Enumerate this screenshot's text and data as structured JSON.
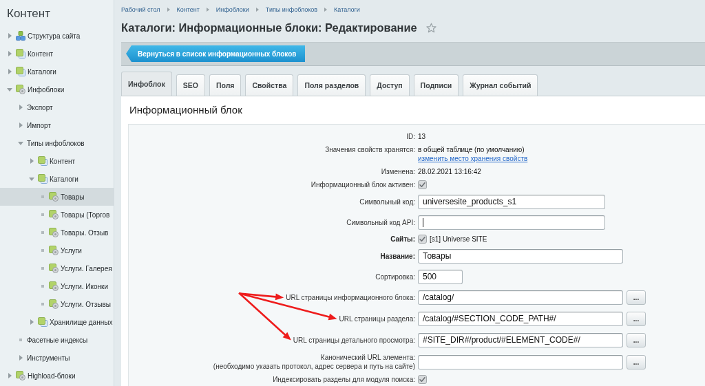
{
  "sidebar": {
    "title": "Контент",
    "items": [
      {
        "label": "Структура сайта",
        "kind": "structure",
        "leaf": false,
        "expanded": false,
        "selected": false
      },
      {
        "label": "Контент",
        "kind": "folder",
        "leaf": false,
        "expanded": false,
        "selected": false
      },
      {
        "label": "Каталоги",
        "kind": "folder",
        "leaf": false,
        "expanded": false,
        "selected": false
      },
      {
        "label": "Инфоблоки",
        "kind": "iblock",
        "leaf": false,
        "expanded": true,
        "selected": false,
        "children": [
          {
            "label": "Экспорт",
            "leaf": false,
            "expanded": false,
            "selected": false
          },
          {
            "label": "Импорт",
            "leaf": false,
            "expanded": false,
            "selected": false
          },
          {
            "label": "Типы инфоблоков",
            "leaf": false,
            "expanded": true,
            "selected": false,
            "children": [
              {
                "label": "Контент",
                "kind": "folder",
                "leaf": false,
                "expanded": false,
                "selected": false
              },
              {
                "label": "Каталоги",
                "kind": "folder",
                "leaf": false,
                "expanded": true,
                "selected": false,
                "children": [
                  {
                    "label": "Товары",
                    "kind": "iblock",
                    "leaf": true,
                    "selected": true
                  },
                  {
                    "label": "Товары (Торгов",
                    "kind": "iblock",
                    "leaf": true,
                    "selected": false
                  },
                  {
                    "label": "Товары. Отзыв",
                    "kind": "iblock",
                    "leaf": true,
                    "selected": false
                  },
                  {
                    "label": "Услуги",
                    "kind": "iblock",
                    "leaf": true,
                    "selected": false
                  },
                  {
                    "label": "Услуги. Галерея",
                    "kind": "iblock",
                    "leaf": true,
                    "selected": false
                  },
                  {
                    "label": "Услуги. Иконки",
                    "kind": "iblock",
                    "leaf": true,
                    "selected": false
                  },
                  {
                    "label": "Услуги. Отзывы",
                    "kind": "iblock",
                    "leaf": true,
                    "selected": false
                  }
                ]
              },
              {
                "label": "Хранилище данных",
                "kind": "folder",
                "leaf": false,
                "expanded": false,
                "selected": false
              }
            ]
          },
          {
            "label": "Фасетные индексы",
            "leaf": true,
            "selected": false
          },
          {
            "label": "Инструменты",
            "leaf": false,
            "expanded": false,
            "selected": false
          }
        ]
      },
      {
        "label": "Highload-блоки",
        "kind": "iblock",
        "leaf": false,
        "expanded": false,
        "selected": false
      }
    ]
  },
  "breadcrumbs": [
    "Рабочий стол",
    "Контент",
    "Инфоблоки",
    "Типы инфоблоков",
    "Каталоги"
  ],
  "page": {
    "title": "Каталоги: Информационные блоки: Редактирование",
    "favorite": false
  },
  "toolbar": {
    "back_button": "Вернуться в список информационных блоков"
  },
  "tabs": [
    {
      "label": "Инфоблок",
      "selected": true
    },
    {
      "label": "SEO",
      "selected": false
    },
    {
      "label": "Поля",
      "selected": false
    },
    {
      "label": "Свойства",
      "selected": false
    },
    {
      "label": "Поля разделов",
      "selected": false
    },
    {
      "label": "Доступ",
      "selected": false
    },
    {
      "label": "Подписи",
      "selected": false
    },
    {
      "label": "Журнал событий",
      "selected": false
    }
  ],
  "panel": {
    "title": "Информационный блок",
    "rows": [
      {
        "kind": "text",
        "label": "ID:",
        "required": false,
        "value": "13"
      },
      {
        "kind": "text",
        "label": "Значения свойств хранятся:",
        "required": false,
        "value": "в общей таблице (по умолчанию)",
        "link": "изменить место хранения свойств"
      },
      {
        "kind": "text",
        "label": "Изменена:",
        "required": false,
        "value": "28.02.2021 13:16:42"
      },
      {
        "kind": "checkbox",
        "label": "Информационный блок активен:",
        "required": false,
        "checked": true
      },
      {
        "kind": "code",
        "label": "Символьный код:",
        "required": false,
        "value": "universesite_products_s1",
        "focused": false
      },
      {
        "kind": "code",
        "label": "Символьный код API:",
        "required": false,
        "focused": true
      },
      {
        "kind": "checkbox",
        "label": "Сайты:",
        "required": true,
        "checked": true,
        "value": "[s1] Universe SITE"
      },
      {
        "kind": "input",
        "label": "Название:",
        "required": true,
        "value": "Товары",
        "focused": false
      },
      {
        "kind": "number",
        "label": "Сортировка:",
        "required": false,
        "value": "500",
        "focused": false
      },
      {
        "kind": "url",
        "label": "URL страницы информационного блока:",
        "required": false,
        "value": "/catalog/",
        "button": "...",
        "focused": false,
        "arrow": true
      },
      {
        "kind": "url",
        "label": "URL страницы раздела:",
        "required": false,
        "value": "/catalog/#SECTION_CODE_PATH#/",
        "button": "...",
        "focused": false,
        "arrow": true
      },
      {
        "kind": "url",
        "label": "URL страницы детального просмотра:",
        "required": false,
        "value": "#SITE_DIR#/product/#ELEMENT_CODE#/",
        "button": "...",
        "focused": false,
        "arrow": true
      },
      {
        "kind": "url",
        "label": "Канонический URL элемента:",
        "hint": "(необходимо указать протокол, адрес сервера и путь на сайте)",
        "required": false,
        "button": "...",
        "focused": false,
        "arrow": false
      },
      {
        "kind": "checkbox",
        "label": "Индексировать разделы для модуля поиска:",
        "required": false,
        "checked": true
      }
    ]
  }
}
